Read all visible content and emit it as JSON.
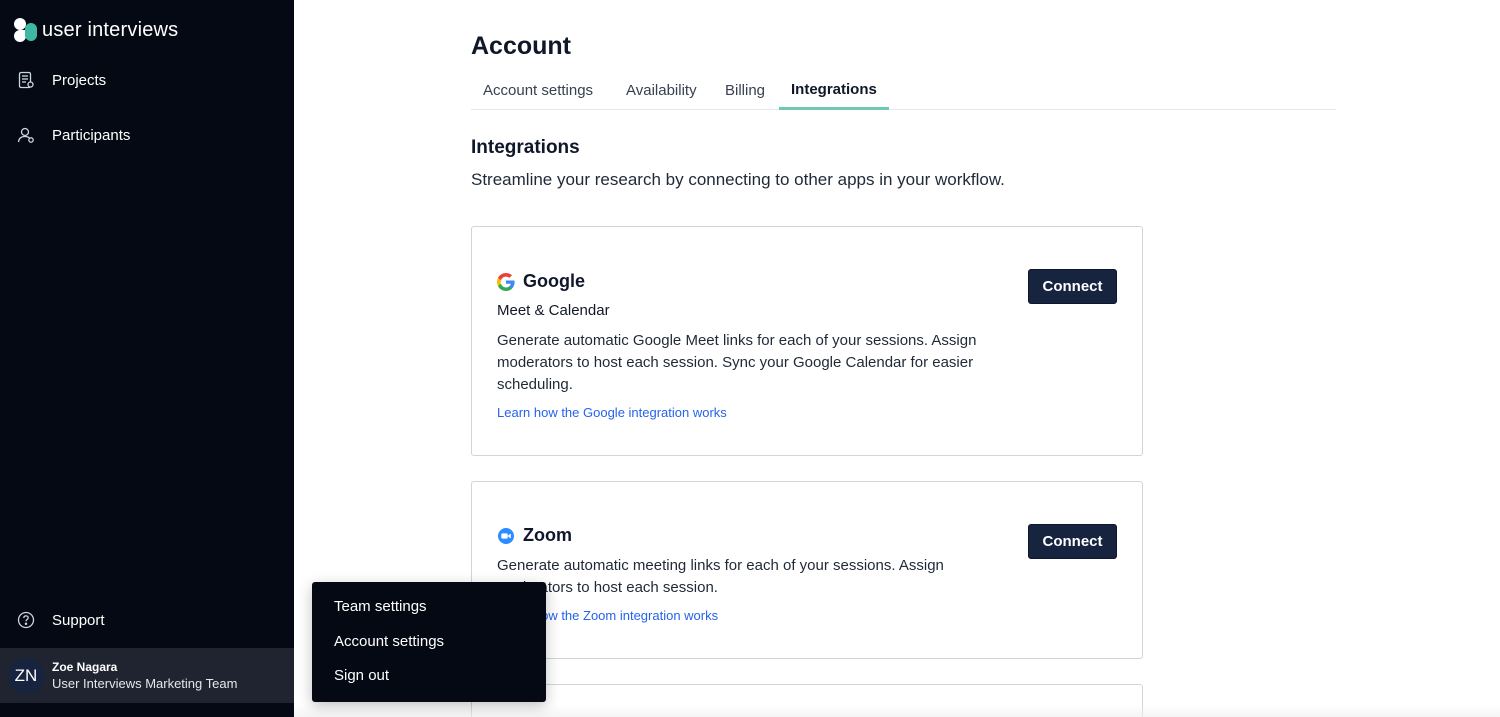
{
  "app": {
    "logo_text": "user interviews"
  },
  "sidebar": {
    "nav": [
      {
        "label": "Projects",
        "icon": "document-list-icon"
      },
      {
        "label": "Participants",
        "icon": "person-icon"
      }
    ],
    "support_label": "Support",
    "user": {
      "initials": "ZN",
      "name": "Zoe Nagara",
      "team": "User Interviews Marketing Team"
    }
  },
  "popover": {
    "items": [
      "Team settings",
      "Account settings",
      "Sign out"
    ]
  },
  "main": {
    "title": "Account",
    "tabs": [
      {
        "label": "Account settings",
        "active": false
      },
      {
        "label": "Availability",
        "active": false
      },
      {
        "label": "Billing",
        "active": false
      },
      {
        "label": "Integrations",
        "active": true
      }
    ],
    "section_title": "Integrations",
    "section_subtitle": "Streamline your research by connecting to other apps in your workflow.",
    "integrations": [
      {
        "name": "Google",
        "icon": "google-icon",
        "subtitle": "Meet & Calendar",
        "description": "Generate automatic Google Meet links for each of your sessions. Assign moderators to host each session. Sync your Google Calendar for easier scheduling.",
        "link": "Learn how the Google integration works",
        "button": "Connect"
      },
      {
        "name": "Zoom",
        "icon": "zoom-icon",
        "description": "Generate automatic meeting links for each of your sessions. Assign moderators to host each session.",
        "link": "Learn how the Zoom integration works",
        "button": "Connect"
      }
    ]
  },
  "colors": {
    "sidebar_bg": "#050914",
    "button_bg": "#16243f",
    "tab_accent": "#6fc7b6",
    "link": "#2563eb",
    "logo_accent": "#3fb8a3"
  }
}
